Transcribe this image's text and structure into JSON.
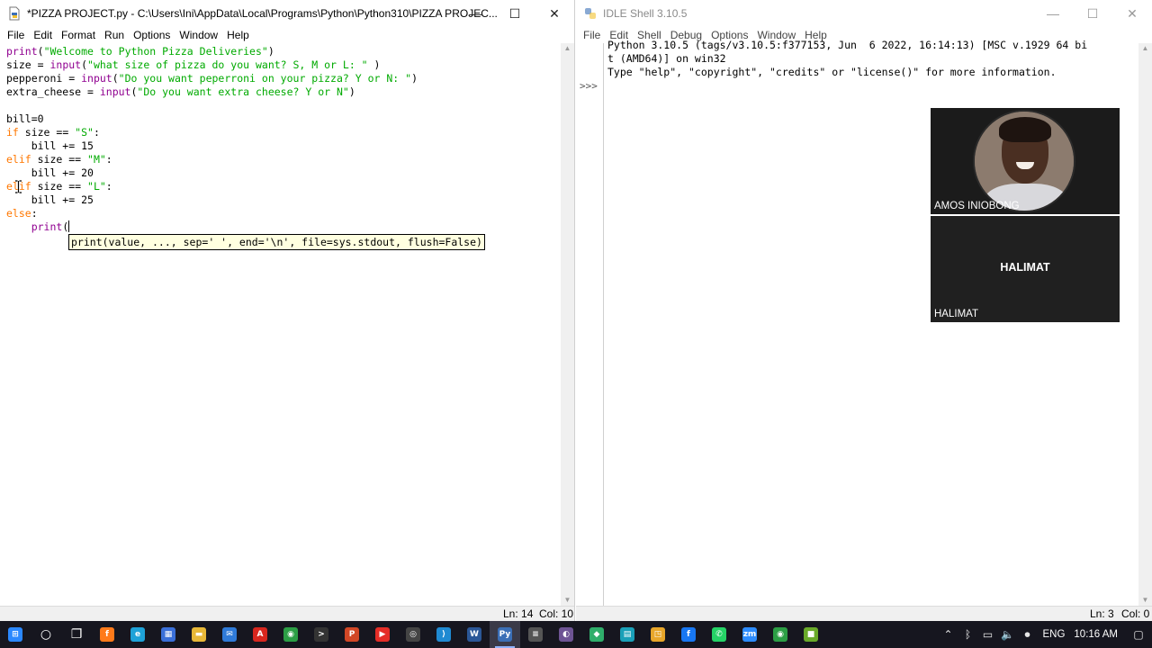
{
  "editor_window": {
    "title": "*PIZZA PROJECT.py - C:\\Users\\Ini\\AppData\\Local\\Programs\\Python\\Python310\\PIZZA PROJEC...",
    "controls": {
      "minimize": "—",
      "maximize": "☐",
      "close": "✕"
    },
    "menu": [
      "File",
      "Edit",
      "Format",
      "Run",
      "Options",
      "Window",
      "Help"
    ],
    "calltip": "print(value, ..., sep=' ', end='\\n', file=sys.stdout, flush=False)",
    "status": {
      "line": "Ln: 14",
      "col": "Col: 10"
    }
  },
  "code": {
    "l1": [
      "print",
      "(",
      "\"Welcome to Python Pizza Deliveries\"",
      ")"
    ],
    "l2": [
      "size = ",
      "input",
      "(",
      "\"what size of pizza do you want? S, M or L: \"",
      " )"
    ],
    "l3": [
      "pepperoni = ",
      "input",
      "(",
      "\"Do you want peperroni on your pizza? Y or N: \"",
      ")"
    ],
    "l4": [
      "extra_cheese = ",
      "input",
      "(",
      "\"Do you want extra cheese? Y or N\"",
      ")"
    ],
    "l6": "bill=0",
    "l7": [
      "if",
      " size == ",
      "\"S\"",
      ":"
    ],
    "l8": "    bill += 15",
    "l9": [
      "elif",
      " size == ",
      "\"M\"",
      ":"
    ],
    "l10": "    bill += 20",
    "l11": [
      "elif",
      " size == ",
      "\"L\"",
      ":"
    ],
    "l12": "    bill += 25",
    "l13": [
      "else",
      ":"
    ],
    "l14": [
      "    ",
      "print",
      "("
    ]
  },
  "shell_window": {
    "title": "IDLE Shell 3.10.5",
    "controls": {
      "minimize": "—",
      "maximize": "☐",
      "close": "✕"
    },
    "menu": [
      "File",
      "Edit",
      "Shell",
      "Debug",
      "Options",
      "Window",
      "Help"
    ],
    "banner_1": "Python 3.10.5 (tags/v3.10.5:f377153, Jun  6 2022, 16:14:13) [MSC v.1929 64 bi",
    "banner_2": "t (AMD64)] on win32",
    "banner_3": "Type \"help\", \"copyright\", \"credits\" or \"license()\" for more information.",
    "prompt": ">>>",
    "status": {
      "line": "Ln: 3",
      "col": "Col: 0"
    }
  },
  "video": {
    "participant_1": "AMOS INIOBONG",
    "participant_2_center": "HALIMAT",
    "participant_2_label": "HALIMAT"
  },
  "taskbar": {
    "apps": [
      {
        "name": "start",
        "glyph": "⊞",
        "color": "#2b88ff"
      },
      {
        "name": "search",
        "glyph": "○",
        "color": "#16161f"
      },
      {
        "name": "task-view",
        "glyph": "❐",
        "color": "#16161f"
      },
      {
        "name": "firefox",
        "glyph": "f",
        "color": "#ff7a1a"
      },
      {
        "name": "edge",
        "glyph": "e",
        "color": "#1ea2d8"
      },
      {
        "name": "store",
        "glyph": "▦",
        "color": "#3a6fd8"
      },
      {
        "name": "file-explorer",
        "glyph": "▬",
        "color": "#e8b838"
      },
      {
        "name": "mail",
        "glyph": "✉",
        "color": "#2f7ad8"
      },
      {
        "name": "acrobat",
        "glyph": "A",
        "color": "#d8261e"
      },
      {
        "name": "chrome",
        "glyph": "◉",
        "color": "#2c9e45"
      },
      {
        "name": "terminal",
        "glyph": ">",
        "color": "#333333"
      },
      {
        "name": "powerpoint",
        "glyph": "P",
        "color": "#d24726"
      },
      {
        "name": "youtube",
        "glyph": "▶",
        "color": "#e52d27"
      },
      {
        "name": "obs",
        "glyph": "◎",
        "color": "#444444"
      },
      {
        "name": "vscode",
        "glyph": "⟩",
        "color": "#1f8ad2"
      },
      {
        "name": "word",
        "glyph": "W",
        "color": "#2b5797"
      },
      {
        "name": "idle",
        "glyph": "Py",
        "color": "#3b6fb6"
      },
      {
        "name": "notepad",
        "glyph": "≡",
        "color": "#555555"
      },
      {
        "name": "github",
        "glyph": "◐",
        "color": "#6e5494"
      },
      {
        "name": "vpn",
        "glyph": "◆",
        "color": "#2fae6a"
      },
      {
        "name": "table-app",
        "glyph": "▤",
        "color": "#1aa0b8"
      },
      {
        "name": "app-sketch",
        "glyph": "◳",
        "color": "#e8a62a"
      },
      {
        "name": "facebook",
        "glyph": "f",
        "color": "#1877f2"
      },
      {
        "name": "whatsapp",
        "glyph": "✆",
        "color": "#25d366"
      },
      {
        "name": "zoom",
        "glyph": "zm",
        "color": "#2d8cff"
      },
      {
        "name": "chrome-2",
        "glyph": "◉",
        "color": "#2c9e45"
      },
      {
        "name": "minecraft",
        "glyph": "■",
        "color": "#6aaa2a"
      }
    ],
    "tray": {
      "chevron": "⌃",
      "bluetooth": "ᛒ",
      "network": "▭",
      "volume": "🔈",
      "mic": "⏺",
      "language": "ENG",
      "time": "10:16 AM",
      "notifications": "▢"
    }
  }
}
